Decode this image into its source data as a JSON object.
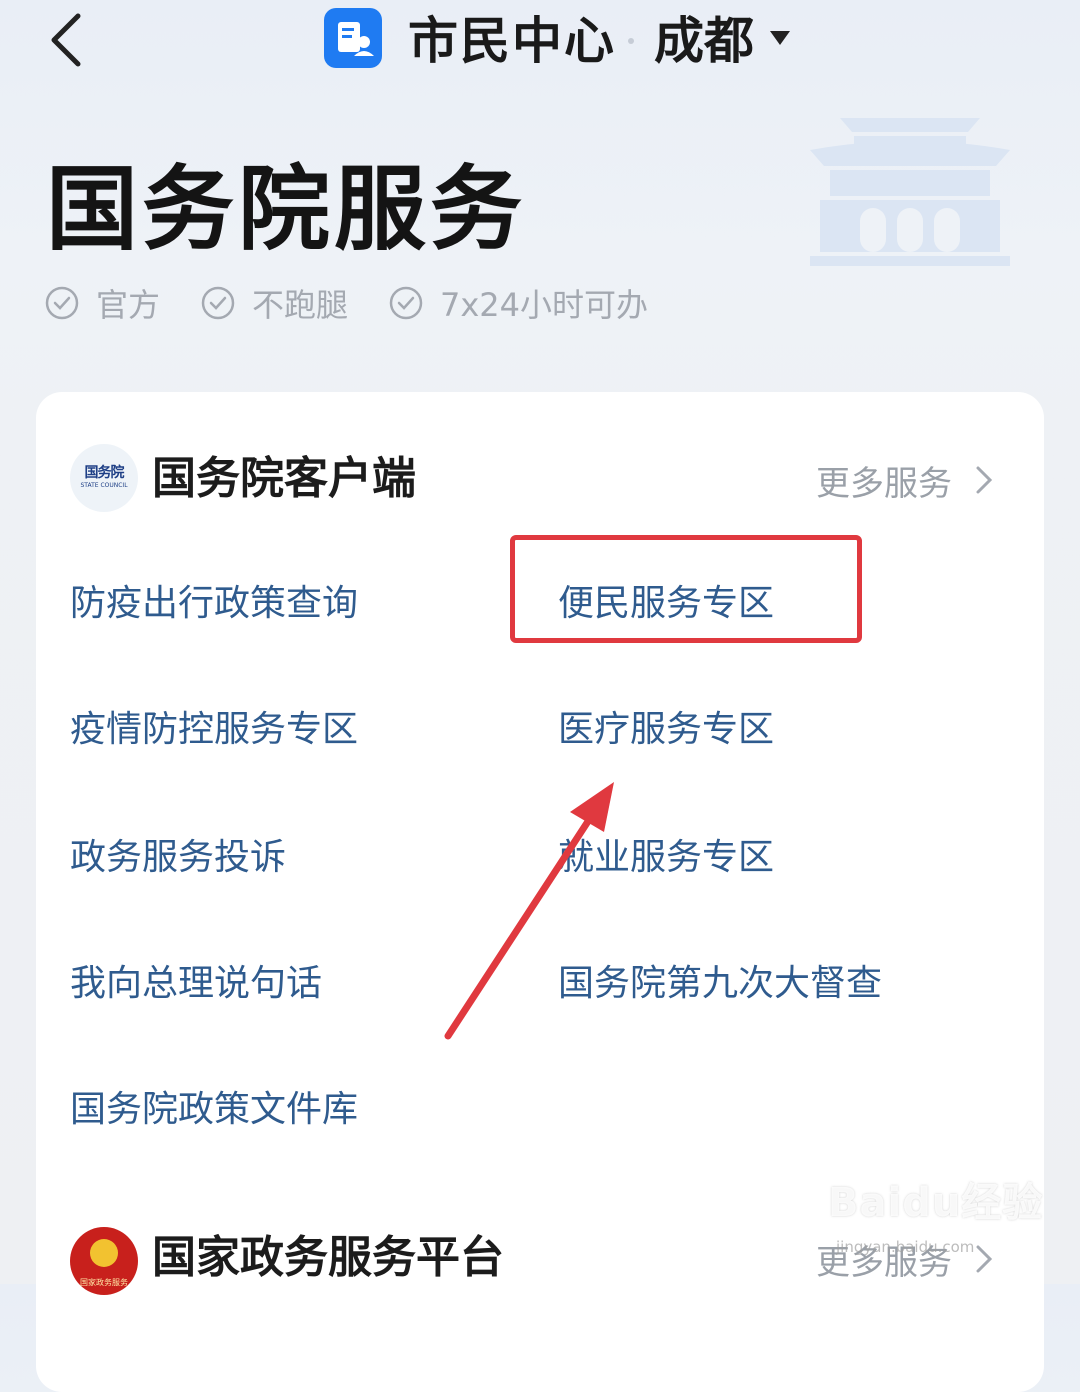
{
  "header": {
    "title": "市民中心",
    "city": "成都"
  },
  "hero": {
    "title": "国务院服务",
    "tags": [
      "官方",
      "不跑腿",
      "7x24小时可办"
    ]
  },
  "card": {
    "logo_text": "国务院",
    "logo_sub": "STATE COUNCIL",
    "title": "国务院客户端",
    "more_label": "更多服务",
    "services": [
      "防疫出行政策查询",
      "便民服务专区",
      "疫情防控服务专区",
      "医疗服务专区",
      "政务服务投诉",
      "就业服务专区",
      "我向总理说句话",
      "国务院第九次大督查",
      "国务院政策文件库"
    ]
  },
  "second": {
    "emblem_text": "国家政务服务",
    "title": "国家政务服务平台",
    "more_label": "更多服务"
  },
  "watermark": {
    "logo": "Baidu经验",
    "url": "jingyan.baidu.com"
  },
  "colors": {
    "accent": "#1f7bf2",
    "link": "#2f5b8e",
    "annotation": "#e0393f"
  }
}
